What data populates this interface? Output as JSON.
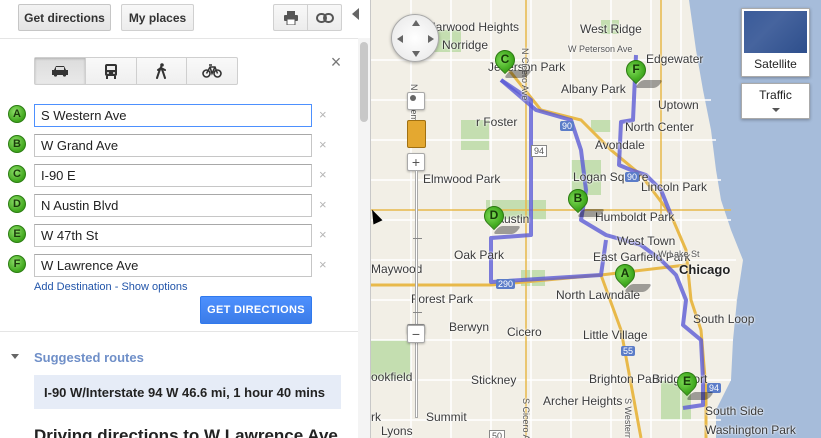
{
  "toolbar": {
    "get_directions_tab": "Get directions",
    "my_places_tab": "My places",
    "print_icon": "print-icon",
    "link_icon": "link-icon"
  },
  "travel_modes": [
    {
      "name": "car-icon",
      "active": true
    },
    {
      "name": "transit-icon",
      "active": false
    },
    {
      "name": "walking-icon",
      "active": false
    },
    {
      "name": "bicycle-icon",
      "active": false
    }
  ],
  "waypoints": [
    {
      "letter": "A",
      "value": "S Western Ave"
    },
    {
      "letter": "B",
      "value": "W Grand Ave"
    },
    {
      "letter": "C",
      "value": "I-90 E"
    },
    {
      "letter": "D",
      "value": "N Austin Blvd"
    },
    {
      "letter": "E",
      "value": "W 47th St"
    },
    {
      "letter": "F",
      "value": "W Lawrence Ave"
    }
  ],
  "remove_glyph": "×",
  "close_glyph": "×",
  "add_destination": "Add Destination",
  "separator": " - ",
  "show_options": "Show options",
  "get_directions_button": "GET DIRECTIONS",
  "suggested_routes_label": "Suggested routes",
  "route_summary": "I-90 W/Interstate 94 W  46.6 mi, 1 hour 40 mins",
  "directions_heading": "Driving directions to W Lawrence Ave",
  "map": {
    "satellite_label": "Satellite",
    "traffic_label": "Traffic",
    "zoom_in": "+",
    "zoom_out": "−",
    "labels": {
      "harwood_heights": "Harwood Heights",
      "norridge": "Norridge",
      "west_ridge": "West Ridge",
      "w_peterson_ave": "W Peterson Ave",
      "edgewater": "Edgewater",
      "jefferson_park": "Jefferson Park",
      "n_cicero_ave": "N Cicero Ave",
      "n_harlem_ave": "N Harlem Ave",
      "albany_park": "Albany Park",
      "uptown": "Uptown",
      "r_foster": "r Foster",
      "north_center": "North Center",
      "avondale": "Avondale",
      "elmwood_park": "Elmwood Park",
      "logan_square": "Logan Square",
      "lincoln_park": "Lincoln Park",
      "austin": "Austin",
      "humboldt_park": "Humboldt Park",
      "west_town": "West Town",
      "oak_park": "Oak Park",
      "east_garfield_park": "East Garfield Park",
      "chicago": "Chicago",
      "maywood": "Maywood",
      "forest_park": "Forest Park",
      "north_lawndale": "North Lawndale",
      "w_lake_st": "W Lake St",
      "south_loop": "South Loop",
      "berwyn": "Berwyn",
      "cicero": "Cicero",
      "little_village": "Little Village",
      "ookfield": "ookfield",
      "stickney": "Stickney",
      "brighton_park": "Brighton Park",
      "bridgeport": "Bridgeport",
      "archer_heights": "Archer Heights",
      "south_side": "South Side",
      "washington_park": "Washington Park",
      "s_western_ave": "S Western Ave",
      "s_cicero_ave": "S Cicero Ave",
      "rk": "rk",
      "summit": "Summit",
      "lyons": "Lyons"
    },
    "highway_shields": [
      "90",
      "90",
      "94",
      "50",
      "290",
      "290",
      "55",
      "94",
      "50"
    ],
    "pins": [
      "A",
      "B",
      "C",
      "D",
      "E",
      "F"
    ],
    "route_color": "#5b5bd6",
    "highway_color": "#e8b94a",
    "water_color": "#a6bcda",
    "land_color": "#f2efe6",
    "park_color": "#c4deb0"
  },
  "colors": {
    "accent_blue": "#4d90fe",
    "link_blue": "#2255aa",
    "marker_green": "#3fa51c",
    "suggested_label": "#6f8fc8",
    "route_box_bg": "#e6ecf7"
  }
}
